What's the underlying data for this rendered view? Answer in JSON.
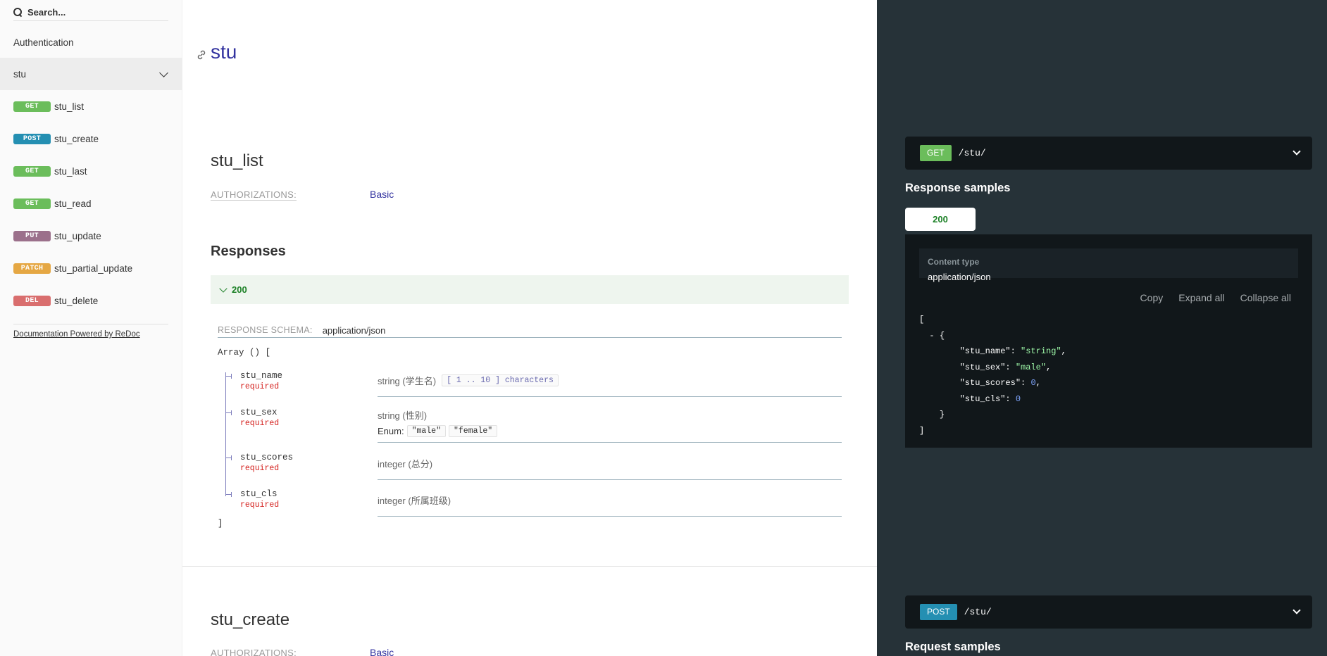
{
  "search": {
    "placeholder": "Search..."
  },
  "sidebar": {
    "items": [
      {
        "label": "Authentication"
      },
      {
        "label": "stu"
      }
    ],
    "operations": [
      {
        "method": "GET",
        "label": "stu_list"
      },
      {
        "method": "POST",
        "label": "stu_create"
      },
      {
        "method": "GET",
        "label": "stu_last"
      },
      {
        "method": "GET",
        "label": "stu_read"
      },
      {
        "method": "PUT",
        "label": "stu_update"
      },
      {
        "method": "PATCH",
        "label": "stu_partial_update"
      },
      {
        "method": "DEL",
        "label": "stu_delete"
      }
    ],
    "powered_by": "Documentation Powered by ReDoc"
  },
  "main": {
    "section_title": "stu",
    "op1": {
      "title": "stu_list",
      "auth_label": "AUTHORIZATIONS:",
      "auth_value": "Basic",
      "responses_title": "Responses",
      "response_code": "200",
      "schema_label": "RESPONSE SCHEMA:",
      "schema_type": "application/json",
      "array_open": "Array () [",
      "array_close": "]",
      "properties": [
        {
          "name": "stu_name",
          "required": "required",
          "type": "string (学生名)",
          "constraint": "[ 1 .. 10 ] characters"
        },
        {
          "name": "stu_sex",
          "required": "required",
          "type": "string (性别)",
          "enum_label": "Enum:",
          "enum_values": [
            "\"male\"",
            "\"female\""
          ]
        },
        {
          "name": "stu_scores",
          "required": "required",
          "type": "integer (总分)"
        },
        {
          "name": "stu_cls",
          "required": "required",
          "type": "integer (所属班级)"
        }
      ]
    },
    "op2": {
      "title": "stu_create",
      "auth_label": "AUTHORIZATIONS:",
      "auth_value": "Basic"
    }
  },
  "right": {
    "endpoint1": {
      "method": "GET",
      "path": "/stu/"
    },
    "response_samples_title": "Response samples",
    "tab_label": "200",
    "content_type_label": "Content type",
    "content_type_value": "application/json",
    "actions": {
      "copy": "Copy",
      "expand": "Expand all",
      "collapse": "Collapse all"
    },
    "json_lines": {
      "open_bracket": "[",
      "minus": "-",
      "open_brace": "{",
      "k1": "\"stu_name\"",
      "v1": "\"string\"",
      "k2": "\"stu_sex\"",
      "v2": "\"male\"",
      "k3": "\"stu_scores\"",
      "v3": "0",
      "k4": "\"stu_cls\"",
      "v4": "0",
      "close_brace": "}",
      "close_bracket": "]"
    },
    "endpoint2": {
      "method": "POST",
      "path": "/stu/"
    },
    "request_samples_title": "Request samples"
  },
  "colors": {
    "get": "#6bbd5b",
    "post": "#248fb2",
    "put": "#9b708b",
    "patch": "#e5a743",
    "delete": "#cc3333",
    "link": "#32329f",
    "success": "#1d8127",
    "right_panel_bg": "#263238"
  },
  "icons": {
    "search": "search-icon",
    "link": "link-icon",
    "chevron": "chevron-down-icon"
  }
}
